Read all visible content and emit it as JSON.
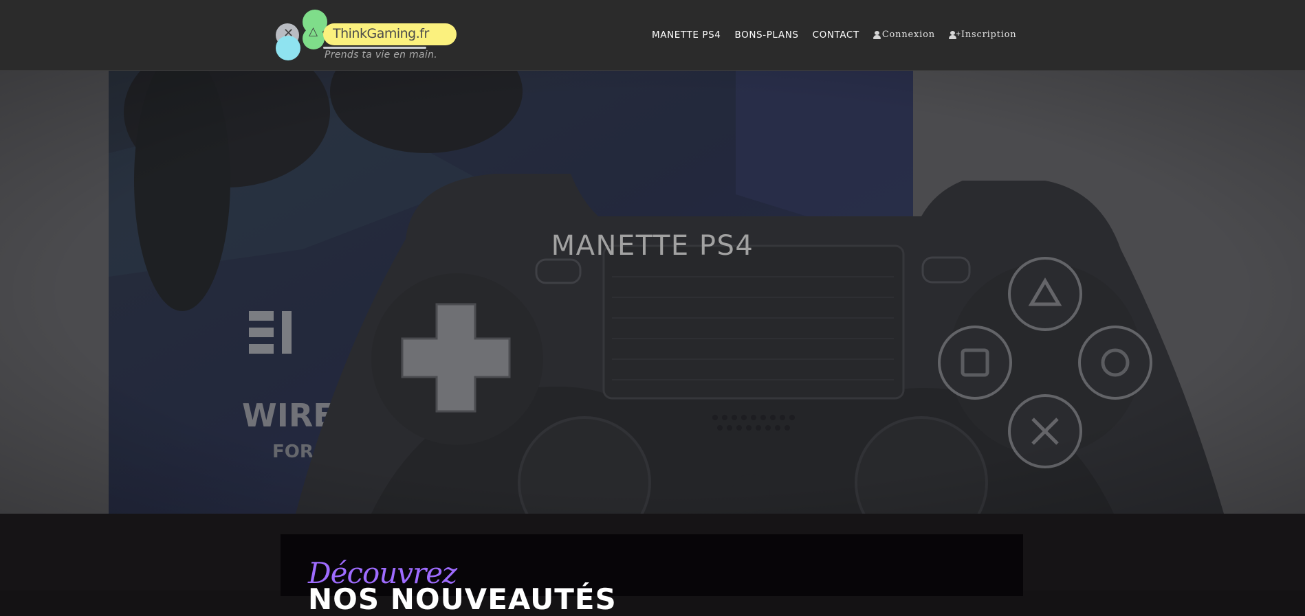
{
  "header": {
    "logo": {
      "name": "ThinkGaming.fr",
      "tagline": "Prends ta vie en main.",
      "glyph_cross": "✕",
      "glyph_triangle": "△"
    },
    "nav": {
      "items": [
        {
          "label": "Manette PS4"
        },
        {
          "label": "Bons-Plans"
        },
        {
          "label": "Contact"
        }
      ],
      "login_label": "Connexion",
      "signup_label": "Inscription",
      "login_icon": "user-icon",
      "signup_icon": "user-plus-icon"
    }
  },
  "hero": {
    "title": "MANETTE PS4"
  },
  "news": {
    "script_text": "Découvrez",
    "heading": "NOS NOUVEAUTÉS"
  },
  "colors": {
    "header_bg": "#2b2b2b",
    "logo_yellow": "#fbf17e",
    "logo_green": "#7fdd8a",
    "logo_cyan": "#8fe3f0",
    "accent_purple": "#9f6cff",
    "hero_overlay": "#58585a",
    "section_bg": "#161416"
  }
}
